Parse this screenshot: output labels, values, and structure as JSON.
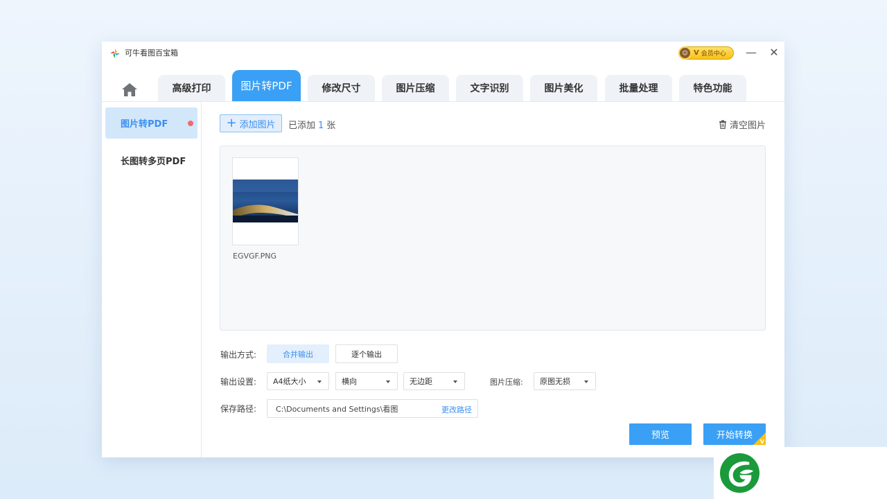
{
  "window": {
    "title": "可牛看图百宝箱",
    "vip_label": "会员中心",
    "vip_badge": "V",
    "minimize_glyph": "—",
    "close_glyph": "✕"
  },
  "tabs": [
    {
      "label": "高级打印"
    },
    {
      "label": "图片转PDF",
      "active": true
    },
    {
      "label": "修改尺寸"
    },
    {
      "label": "图片压缩"
    },
    {
      "label": "文字识别"
    },
    {
      "label": "图片美化"
    },
    {
      "label": "批量处理"
    },
    {
      "label": "特色功能"
    }
  ],
  "sidebar": {
    "items": [
      {
        "label": "图片转PDF",
        "active": true
      },
      {
        "label": "长图转多页PDF"
      }
    ]
  },
  "toolbar": {
    "add_label": "添加图片",
    "added_prefix": "已添加",
    "added_count": "1",
    "added_suffix": "张",
    "clear_label": "清空图片"
  },
  "files": [
    {
      "name": "EGVGF.PNG"
    }
  ],
  "settings": {
    "output_mode_label": "输出方式:",
    "output_mode_options": [
      "合并输出",
      "逐个输出"
    ],
    "output_settings_label": "输出设置:",
    "paper_size": "A4纸大小",
    "orientation": "横向",
    "margin": "无边距",
    "compress_label": "图片压缩:",
    "compress_value": "原图无损",
    "save_path_label": "保存路径:",
    "save_path": "C:\\Documents and Settings\\看图",
    "change_path_label": "更改路径"
  },
  "actions": {
    "preview_label": "预览",
    "start_label": "开始转换",
    "vip_corner": "V"
  },
  "colors": {
    "accent": "#3aa0f5",
    "accent_text": "#3a8ff0",
    "selected_bg": "#d3e7fb",
    "dot": "#f06a6a",
    "vip_gold": "#f7c21b",
    "brand_green": "#1a9a3a"
  }
}
